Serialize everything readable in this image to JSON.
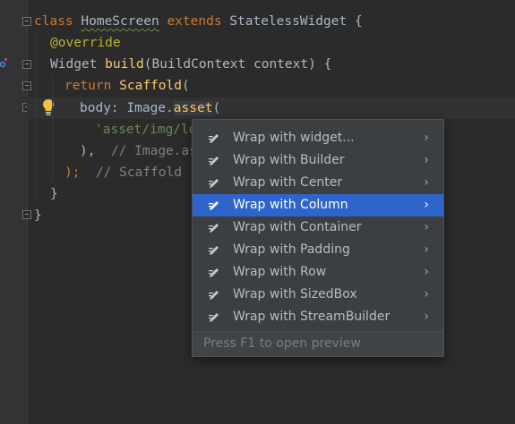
{
  "code": {
    "line1": {
      "kw": "class",
      "name": "HomeScreen",
      "kw2": "extends",
      "parent": "StatelessWidget",
      "brace": " {"
    },
    "line2": {
      "annotation": "@override"
    },
    "line3": {
      "type": "Widget",
      "fn": "build",
      "params": "(BuildContext context) {"
    },
    "line4": {
      "kw": "return",
      "fn": "Scaffold",
      "rest": "("
    },
    "line5": {
      "prop": "body: ",
      "cls": "Image.",
      "fn": "asset",
      "rest": "("
    },
    "line6": {
      "string": "'asset/img/lo"
    },
    "line7": {
      "text": "),",
      "comment": "// Image.as"
    },
    "line8": {
      "text": ");",
      "comment": "// Scaffold"
    },
    "line9": {
      "text": "}"
    },
    "line10": {
      "text": "}"
    }
  },
  "menu": {
    "items": [
      {
        "label": "Wrap with widget...",
        "icon": "edit-icon",
        "arrow": "›"
      },
      {
        "label": "Wrap with Builder",
        "icon": "edit-icon",
        "arrow": "›"
      },
      {
        "label": "Wrap with Center",
        "icon": "edit-icon",
        "arrow": "›"
      },
      {
        "label": "Wrap with Column",
        "icon": "edit-icon",
        "arrow": "›"
      },
      {
        "label": "Wrap with Container",
        "icon": "edit-icon",
        "arrow": "›"
      },
      {
        "label": "Wrap with Padding",
        "icon": "edit-icon",
        "arrow": "›"
      },
      {
        "label": "Wrap with Row",
        "icon": "edit-icon",
        "arrow": "›"
      },
      {
        "label": "Wrap with SizedBox",
        "icon": "edit-icon",
        "arrow": "›"
      },
      {
        "label": "Wrap with StreamBuilder",
        "icon": "edit-icon",
        "arrow": "›"
      }
    ],
    "selected_label": "Wrap with Column",
    "footer": "Press F1 to open preview"
  },
  "colors": {
    "background": "#2b2b2b",
    "keyword": "#cc7832",
    "function": "#ffc66d",
    "string": "#6a8759",
    "comment": "#808080",
    "annotation": "#bbb529",
    "selection": "#2f65ca"
  }
}
